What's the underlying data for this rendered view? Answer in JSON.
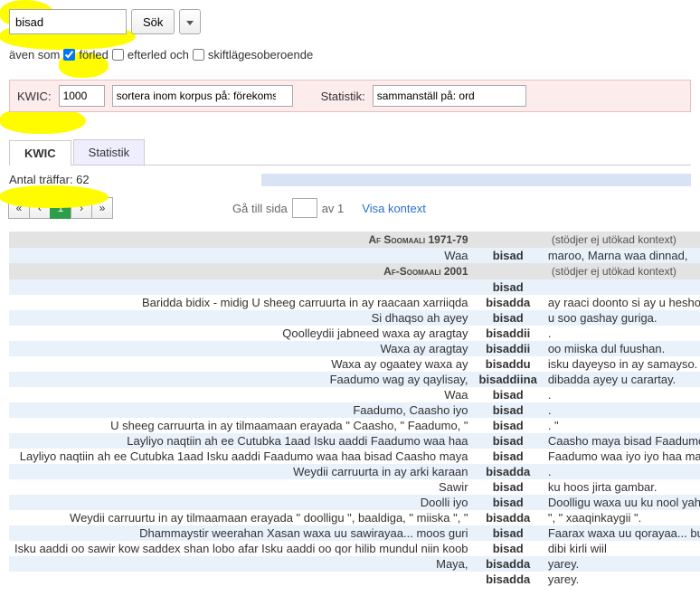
{
  "search": {
    "value": "bisad",
    "button": "Sök"
  },
  "options": {
    "prefix": "även som",
    "forled": "förled",
    "efterled": "efterled och",
    "case": "skiftlägesoberoende"
  },
  "bar": {
    "kwic_label": "KWIC:",
    "kwic_value": "1000",
    "sort_value": "sortera inom korpus på: förekomst",
    "stat_label": "Statistik:",
    "stat_value": "sammanställ på: ord"
  },
  "tabs": {
    "kwic": "KWIC",
    "stat": "Statistik"
  },
  "hits": {
    "label": "Antal träffar: 62"
  },
  "pager": {
    "first": "«",
    "prev": "‹",
    "cur": "1",
    "next": "›",
    "last": "»",
    "goto": "Gå till sida",
    "of": "av 1",
    "context": "Visa kontext"
  },
  "corpora": [
    {
      "name": "Af Soomaali 1971-79",
      "note": "(stödjer ej utökad kontext)"
    },
    {
      "name": "Af-Soomaali 2001",
      "note": "(stödjer ej utökad kontext)"
    }
  ],
  "rows1": [
    {
      "l": "Waa",
      "k": "bisad",
      "r": "maroo, Marna waa dinnad,"
    }
  ],
  "rows2": [
    {
      "l": "",
      "k": "bisad",
      "r": ""
    },
    {
      "l": "Baridda bidix - midig U sheeg carruurta in ay raacaan xarriiqda",
      "k": "bisadda",
      "r": "ay raaci doonto si ay u hesho cunta"
    },
    {
      "l": "Si dhaqso ah ayey",
      "k": "bisad",
      "r": "u soo gashay guriga."
    },
    {
      "l": "Qoolleydii jabneed waxa ay aragtay",
      "k": "bisaddii",
      "r": "."
    },
    {
      "l": "Waxa ay aragtay",
      "k": "bisaddii",
      "r": "oo miiska dul fuushan."
    },
    {
      "l": "Waxa ay ogaatey waxa ay",
      "k": "bisaddu",
      "r": "isku dayeyso in ay samayso."
    },
    {
      "l": "Faadumo wag ay qaylisay,",
      "k": "bisaddiina",
      "r": "dibadda ayey u carartay."
    },
    {
      "l": "Waa",
      "k": "bisad",
      "r": "."
    },
    {
      "l": "Faadumo, Caasho iyo",
      "k": "bisad",
      "r": "."
    },
    {
      "l": "U sheeg carruurta in ay tilmaamaan erayada \" Caasho, \" Faadumo, \"",
      "k": "bisad",
      "r": ". \""
    },
    {
      "l": "Layliyo naqtiin ah ee Cutubka 1aad Isku aaddi Faadumo waa haa",
      "k": "bisad",
      "r": "Caasho maya bisad Faadumo waa "
    },
    {
      "l": "Layliyo naqtiin ah ee Cutubka 1aad Isku aaddi Faadumo waa haa bisad Caasho maya",
      "k": "bisad",
      "r": "Faadumo waa iyo iyo haa maya Ca"
    },
    {
      "l": "Weydii carruurta in ay arki karaan",
      "k": "bisadda",
      "r": "."
    },
    {
      "l": "Sawir",
      "k": "bisad",
      "r": "ku hoos jirta gambar."
    },
    {
      "l": "Doolli iyo",
      "k": "bisad",
      "r": "Doolligu waxa uu ku nool yahay me"
    },
    {
      "l": "Weydii carruurtu in ay tilmaamaan erayada \" doolligu \", baaldiga, \" miiska \", \"",
      "k": "bisadda",
      "r": "\", \" xaaqinkaygii \"."
    },
    {
      "l": "Dhammaystir weerahan Xasan waxa uu sawirayaa... moos guri",
      "k": "bisad",
      "r": "Faarax waxa uu qorayaa... buug ma"
    },
    {
      "l": "Isku aaddi oo sawir kow saddex shan lobo afar Isku aaddi oo qor hilib mundul niin koob",
      "k": "bisad",
      "r": "dibi kirli wiil"
    },
    {
      "l": "Maya,",
      "k": "bisadda",
      "r": "yarey."
    },
    {
      "l": "",
      "k": "bisadda",
      "r": "yarey."
    }
  ]
}
